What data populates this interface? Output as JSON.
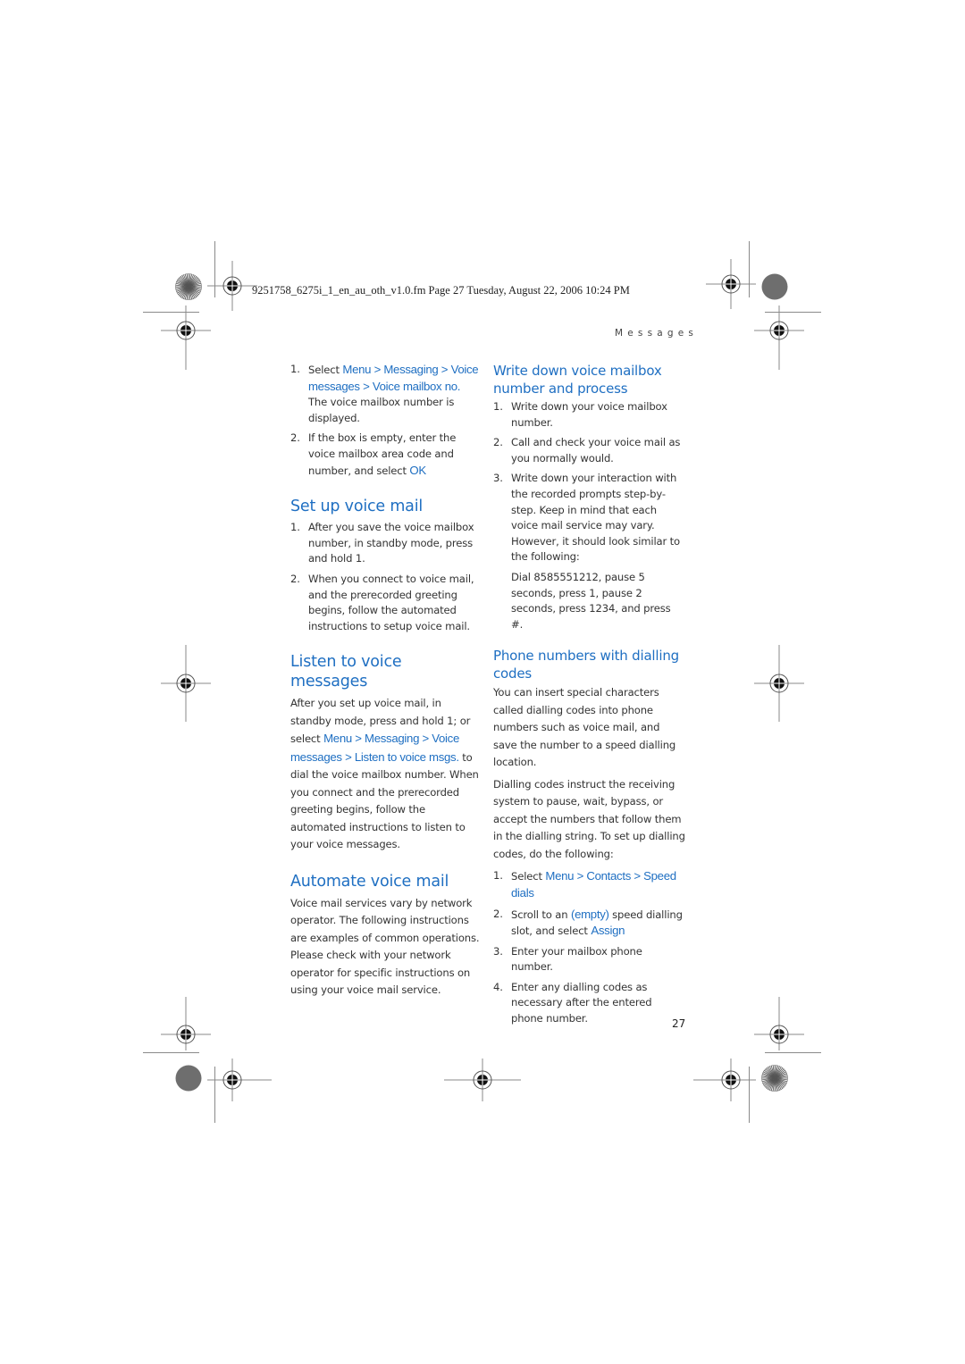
{
  "header": {
    "file_line": "9251758_6275i_1_en_au_oth_v1.0.fm  Page 27  Tuesday, August 22, 2006  10:24 PM",
    "section": "Messages"
  },
  "left_column": {
    "intro_steps": [
      {
        "num": "1.",
        "parts": [
          {
            "t": "Select ",
            "ui": false
          },
          {
            "t": "Menu",
            "ui": true
          },
          {
            "t": " > ",
            "ui": true
          },
          {
            "t": "Messaging",
            "ui": true
          },
          {
            "t": " > ",
            "ui": true
          },
          {
            "t": "Voice messages",
            "ui": true
          },
          {
            "t": " > ",
            "ui": true
          },
          {
            "t": "Voice mailbox no.",
            "ui": true
          },
          {
            "t": " The voice mailbox number is displayed.",
            "ui": false
          }
        ]
      },
      {
        "num": "2.",
        "parts": [
          {
            "t": "If the box is empty, enter the voice mailbox area code and number, and select ",
            "ui": false
          },
          {
            "t": "OK",
            "ui": true
          }
        ]
      }
    ],
    "setup": {
      "heading": "Set up voice mail",
      "steps": [
        {
          "num": "1.",
          "text": "After you save the voice mailbox number, in standby mode, press and hold 1."
        },
        {
          "num": "2.",
          "text": "When you connect to voice mail, and the prerecorded greeting begins, follow the automated instructions to setup voice mail."
        }
      ]
    },
    "listen": {
      "heading": "Listen to voice messages",
      "parts": [
        {
          "t": "After you set up voice mail, in standby mode, press and hold 1; or select ",
          "ui": false
        },
        {
          "t": "Menu",
          "ui": true
        },
        {
          "t": " > ",
          "ui": true
        },
        {
          "t": "Messaging",
          "ui": true
        },
        {
          "t": " > ",
          "ui": true
        },
        {
          "t": "Voice messages",
          "ui": true
        },
        {
          "t": " > ",
          "ui": true
        },
        {
          "t": "Listen to voice msgs.",
          "ui": true
        },
        {
          "t": " to dial the voice mailbox number. When you connect and the prerecorded greeting begins, follow the automated instructions to listen to your voice messages.",
          "ui": false
        }
      ]
    },
    "automate": {
      "heading": "Automate voice mail",
      "text": "Voice mail services vary by network operator. The following instructions are examples of common operations. Please check with your network operator for specific instructions on using your voice mail service."
    }
  },
  "right_column": {
    "write_down": {
      "heading": "Write down voice mailbox number and process",
      "steps": [
        {
          "num": "1.",
          "text": "Write down your voice mailbox number."
        },
        {
          "num": "2.",
          "text": "Call and check your voice mail as you normally would."
        },
        {
          "num": "3.",
          "text": "Write down your interaction with the recorded prompts step-by-step. Keep in mind that each voice mail service may vary. However, it should look similar to the following:"
        }
      ],
      "example": "Dial 8585551212, pause 5 seconds, press 1, pause 2 seconds, press 1234, and press #."
    },
    "dialling_codes": {
      "heading": "Phone numbers with dialling codes",
      "paragraphs": [
        "You can insert special characters called dialling codes into phone numbers such as voice mail, and save the number to a speed dialling location.",
        "Dialling codes instruct the receiving system to pause, wait, bypass, or accept the numbers that follow them in the dialling string. To set up dialling codes, do the following:"
      ],
      "steps": [
        {
          "num": "1.",
          "parts": [
            {
              "t": "Select ",
              "ui": false
            },
            {
              "t": "Menu",
              "ui": true
            },
            {
              "t": " > ",
              "ui": true
            },
            {
              "t": "Contacts",
              "ui": true
            },
            {
              "t": " > ",
              "ui": true
            },
            {
              "t": "Speed dials",
              "ui": true
            }
          ]
        },
        {
          "num": "2.",
          "parts": [
            {
              "t": "Scroll to an ",
              "ui": false
            },
            {
              "t": "(empty)",
              "ui": true
            },
            {
              "t": " speed dialling slot, and select ",
              "ui": false
            },
            {
              "t": "Assign",
              "ui": true
            }
          ]
        },
        {
          "num": "3.",
          "parts": [
            {
              "t": "Enter your mailbox phone number.",
              "ui": false
            }
          ]
        },
        {
          "num": "4.",
          "parts": [
            {
              "t": "Enter any dialling codes as necessary after the entered phone number.",
              "ui": false
            }
          ]
        }
      ]
    }
  },
  "footer": {
    "page_number": "27"
  },
  "colors": {
    "accent_blue": "#1f6fc2",
    "body_text": "#333333"
  }
}
